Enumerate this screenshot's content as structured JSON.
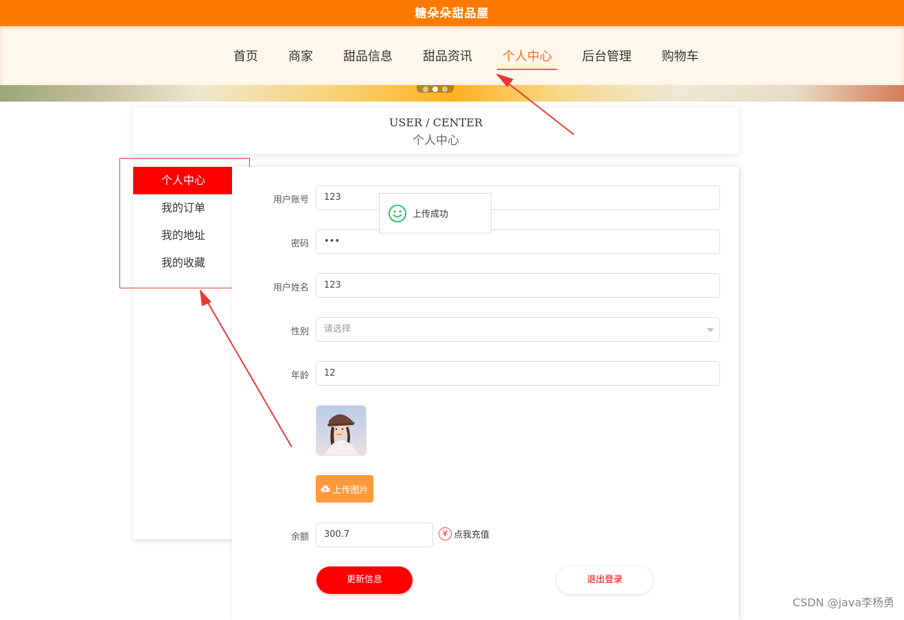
{
  "header": {
    "site_title": "糖朵朵甜品屋"
  },
  "nav": {
    "items": [
      "首页",
      "商家",
      "甜品信息",
      "甜品资讯",
      "个人中心",
      "后台管理",
      "购物车"
    ],
    "active_index": 4
  },
  "page_heading": {
    "en": "USER / CENTER",
    "cn": "个人中心"
  },
  "sidebar": {
    "items": [
      "个人中心",
      "我的订单",
      "我的地址",
      "我的收藏"
    ],
    "active_index": 0
  },
  "form": {
    "account": {
      "label": "用户账号",
      "value": "123"
    },
    "password": {
      "label": "密码",
      "value": "•••"
    },
    "name": {
      "label": "用户姓名",
      "value": "123"
    },
    "gender": {
      "label": "性别",
      "placeholder": "请选择"
    },
    "age": {
      "label": "年龄",
      "value": "12"
    },
    "upload_label": "上传图片",
    "balance": {
      "label": "余额",
      "value": "300.7"
    },
    "recharge": {
      "symbol": "¥",
      "label": "点我充值"
    },
    "update_label": "更新信息",
    "logout_label": "退出登录"
  },
  "toast": {
    "message": "上传成功"
  },
  "watermark": "CSDN @java李杨勇",
  "colors": {
    "brand_orange": "#ff7a00",
    "accent_red": "#ff0000",
    "annotation_red": "#e53935",
    "success_green": "#2ec56b"
  },
  "icons": [
    "smile-icon",
    "cloud-upload-icon",
    "yen-icon",
    "chevron-down-icon"
  ]
}
